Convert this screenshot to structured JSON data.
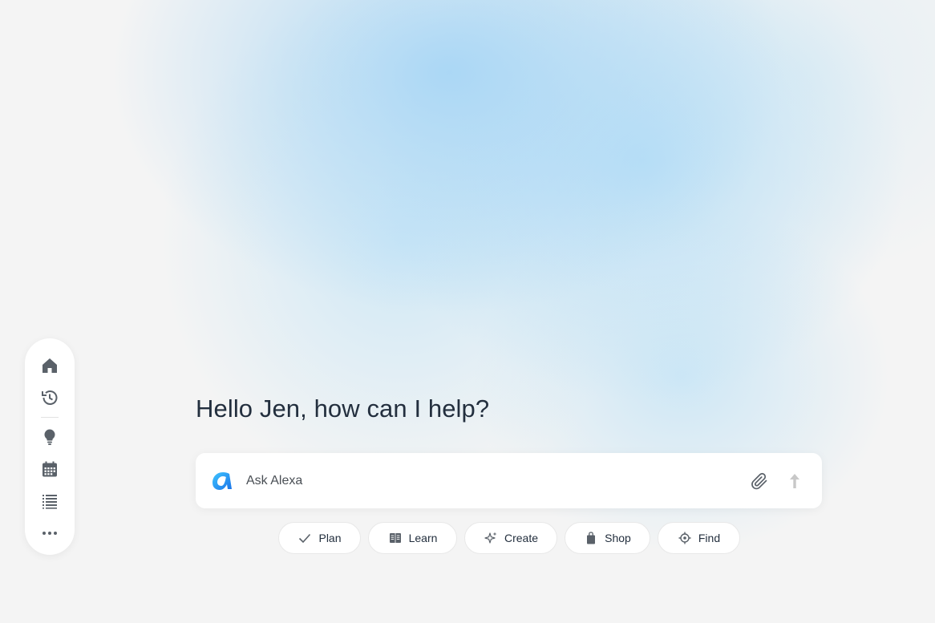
{
  "greeting": "Hello Jen, how can I help?",
  "ask": {
    "placeholder": "Ask Alexa",
    "logo_icon": "alexa-logo-icon",
    "attach_icon": "paperclip-icon",
    "send_icon": "arrow-up-icon"
  },
  "sidebar": {
    "items": [
      {
        "icon": "home-icon"
      },
      {
        "icon": "history-icon"
      },
      {
        "icon": "lightbulb-icon"
      },
      {
        "icon": "calendar-icon"
      },
      {
        "icon": "list-icon"
      },
      {
        "icon": "more-icon"
      }
    ]
  },
  "chips": [
    {
      "label": "Plan",
      "icon": "check-icon"
    },
    {
      "label": "Learn",
      "icon": "book-icon"
    },
    {
      "label": "Create",
      "icon": "sparkle-icon"
    },
    {
      "label": "Shop",
      "icon": "shopping-bag-icon"
    },
    {
      "label": "Find",
      "icon": "target-icon"
    }
  ],
  "colors": {
    "text": "#232f3e",
    "icon": "#5a6169",
    "alexa_blue": "#1ea0f2",
    "send_disabled": "#c8c8c8"
  }
}
